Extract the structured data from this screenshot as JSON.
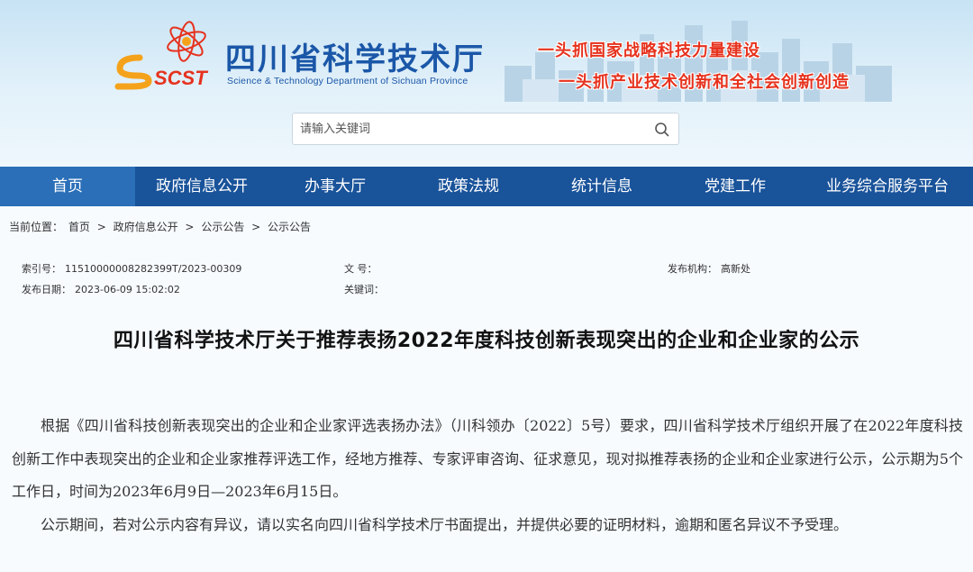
{
  "header": {
    "logo_text": "SCST",
    "site_title": "四川省科学技术厅",
    "site_subtitle": "Science & Technology Department of Sichuan Province",
    "slogan_1": "一头抓国家战略科技力量建设",
    "slogan_2": "一头抓产业技术创新和全社会创新创造",
    "colors": {
      "title": "#1b57a8",
      "slogan": "#e6321e"
    }
  },
  "search": {
    "placeholder": "请输入关键词",
    "icon": "search-icon"
  },
  "nav": {
    "items": [
      {
        "label": "首页"
      },
      {
        "label": "政府信息公开"
      },
      {
        "label": "办事大厅"
      },
      {
        "label": "政策法规"
      },
      {
        "label": "统计信息"
      },
      {
        "label": "党建工作"
      },
      {
        "label": "业务综合服务平台"
      }
    ],
    "active_index": 0,
    "colors": {
      "bar": "#19539a",
      "active": "#2a6fb8"
    }
  },
  "breadcrumb": {
    "label": "当前位置：",
    "items": [
      "首页",
      "政府信息公开",
      "公示公告",
      "公示公告"
    ],
    "separator": ">"
  },
  "meta": {
    "index_label": "索引号：",
    "index_value": "11510000008282399T/2023-00309",
    "docno_label": "文 号：",
    "docno_value": "",
    "publisher_label": "发布机构：",
    "publisher_value": "高新处",
    "date_label": "发布日期：",
    "date_value": "2023-06-09 15:02:02",
    "keywords_label": "关键词：",
    "keywords_value": ""
  },
  "article": {
    "title": "四川省科学技术厅关于推荐表扬2022年度科技创新表现突出的企业和企业家的公示",
    "paragraphs": [
      "根据《四川省科技创新表现突出的企业和企业家评选表扬办法》（川科领办〔2022〕5号）要求，四川省科学技术厅组织开展了在2022年度科技创新工作中表现突出的企业和企业家推荐评选工作，经地方推荐、专家评审咨询、征求意见，现对拟推荐表扬的企业和企业家进行公示，公示期为5个工作日，时间为2023年6月9日—2023年6月15日。",
      "公示期间，若对公示内容有异议，请以实名向四川省科学技术厅书面提出，并提供必要的证明材料，逾期和匿名异议不予受理。"
    ]
  }
}
